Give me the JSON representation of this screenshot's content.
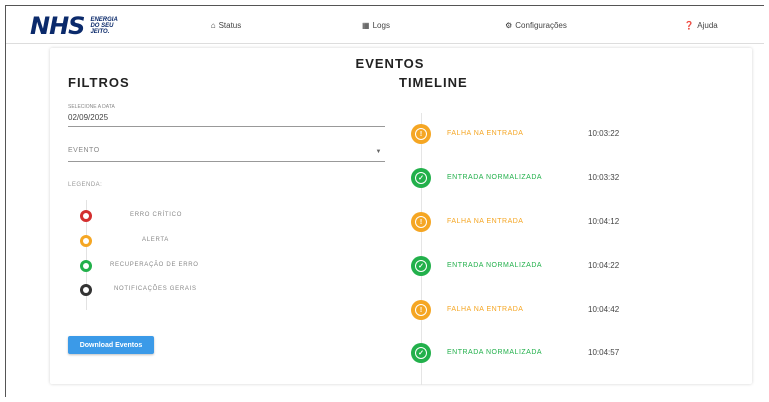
{
  "nav": {
    "logo_mark": "NHS",
    "logo_line1": "ENERGIA",
    "logo_line2": "DO SEU",
    "logo_line3": "JEITO.",
    "status_label": "Status",
    "logs_label": "Logs",
    "config_label": "Configurações",
    "ajuda_label": "Ajuda"
  },
  "page": {
    "title": "EVENTOS"
  },
  "filters": {
    "title": "FILTROS",
    "date_label": "SELECIONE A DATA",
    "date_value": "02/09/2025",
    "event_placeholder": "EVENTO",
    "legend_label": "LEGENDA:",
    "legend": [
      {
        "label": "ERRO CRÍTICO",
        "color": "#d32f2f"
      },
      {
        "label": "ALERTA",
        "color": "#f5a623"
      },
      {
        "label": "RECUPERAÇÃO DE ERRO",
        "color": "#22b04b"
      },
      {
        "label": "NOTIFICAÇÕES GERAIS",
        "color": "#333333"
      }
    ],
    "download_label": "Download Eventos"
  },
  "timeline": {
    "title": "TIMELINE",
    "events": [
      {
        "label": "FALHA NA ENTRADA",
        "time": "10:03:22",
        "kind": "alerta",
        "color": "#f5a623"
      },
      {
        "label": "ENTRADA NORMALIZADA",
        "time": "10:03:32",
        "kind": "recuperacao",
        "color": "#22b04b"
      },
      {
        "label": "FALHA NA ENTRADA",
        "time": "10:04:12",
        "kind": "alerta",
        "color": "#f5a623"
      },
      {
        "label": "ENTRADA NORMALIZADA",
        "time": "10:04:22",
        "kind": "recuperacao",
        "color": "#22b04b"
      },
      {
        "label": "FALHA NA ENTRADA",
        "time": "10:04:42",
        "kind": "alerta",
        "color": "#f5a623"
      },
      {
        "label": "ENTRADA NORMALIZADA",
        "time": "10:04:57",
        "kind": "recuperacao",
        "color": "#22b04b"
      }
    ]
  }
}
